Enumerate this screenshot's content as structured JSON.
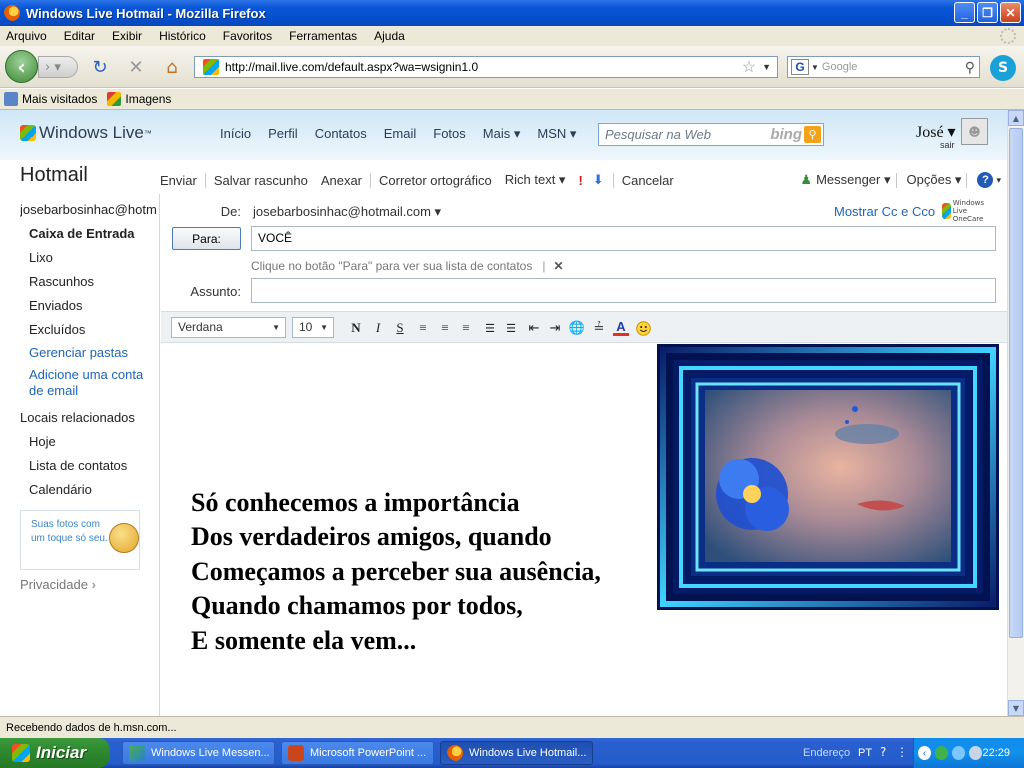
{
  "window": {
    "title": "Windows Live Hotmail - Mozilla Firefox",
    "buttons": {
      "minimize": "_",
      "maximize": "❐",
      "close": "✕"
    }
  },
  "menu": [
    "Arquivo",
    "Editar",
    "Exibir",
    "Histórico",
    "Favoritos",
    "Ferramentas",
    "Ajuda"
  ],
  "navbar": {
    "url": "http://mail.live.com/default.aspx?wa=wsignin1.0",
    "search_placeholder": "Google",
    "search_engine_icon": "G"
  },
  "bookmarks": [
    "Mais visitados",
    "Imagens"
  ],
  "wl_header": {
    "logo": "Windows Live",
    "logo_tm": "™",
    "nav": [
      "Início",
      "Perfil",
      "Contatos",
      "Email",
      "Fotos",
      "Mais ▾",
      "MSN ▾"
    ],
    "search_placeholder": "Pesquisar na Web",
    "bing": "bing",
    "user": "José ▾",
    "signout": "sair"
  },
  "hotmail_title": "Hotmail",
  "toolbar": {
    "send": "Enviar",
    "save_draft": "Salvar rascunho",
    "attach": "Anexar",
    "spellcheck": "Corretor ortográfico",
    "rich_text": "Rich text ▾",
    "importance_high": "!",
    "importance_low": "⬇",
    "cancel": "Cancelar",
    "messenger": "Messenger ▾",
    "options": "Opções ▾",
    "help": "?",
    "help_caret": "▾"
  },
  "leftpane": {
    "account": "josebarbosinhac@hotmail.com",
    "folders": [
      "Caixa de Entrada",
      "Lixo",
      "Rascunhos",
      "Enviados",
      "Excluídos"
    ],
    "manage_folders": "Gerenciar pastas",
    "add_account_1": "Adicione uma conta",
    "add_account_2": "de email",
    "related_heading": "Locais relacionados",
    "related": [
      "Hoje",
      "Lista de contatos",
      "Calendário"
    ],
    "promo_text": "Suas fotos com um toque só seu.",
    "privacy": "Privacidade",
    "privacy_arrow": "›"
  },
  "compose": {
    "from_label": "De:",
    "from_value": "josebarbosinhac@hotmail.com ▾",
    "show_cc": "Mostrar Cc e Cco",
    "onecare": "Windows Live OneCare",
    "to_button": "Para:",
    "to_value": "VOCÊ",
    "hint": "Clique no botão \"Para\" para ver sua lista de contatos",
    "hint_sep": "|",
    "hint_close": "✕",
    "subject_label": "Assunto:",
    "subject_value": ""
  },
  "format": {
    "font": "Verdana",
    "size": "10",
    "bold": "N",
    "italic": "I",
    "underline": "S",
    "font_color_glyph": "A"
  },
  "body": {
    "poem": [
      "Só conhecemos a importância",
      "Dos verdadeiros amigos, quando",
      "Começamos a perceber sua ausência,",
      "Quando chamamos por todos,",
      "E somente ela vem..."
    ]
  },
  "status": "Recebendo dados de h.msn.com...",
  "taskbar": {
    "start": "Iniciar",
    "tasks": [
      {
        "label": "Windows Live Messen..."
      },
      {
        "label": "Microsoft PowerPoint ..."
      },
      {
        "label": "Windows Live Hotmail..."
      }
    ],
    "address": "Endereço",
    "lang": "PT",
    "clock": "22:29"
  },
  "colors": {
    "xp_blue": "#0a56d6",
    "link": "#1f64b5",
    "start_green": "#2f8a2f",
    "tray_blue": "#1290ec"
  }
}
